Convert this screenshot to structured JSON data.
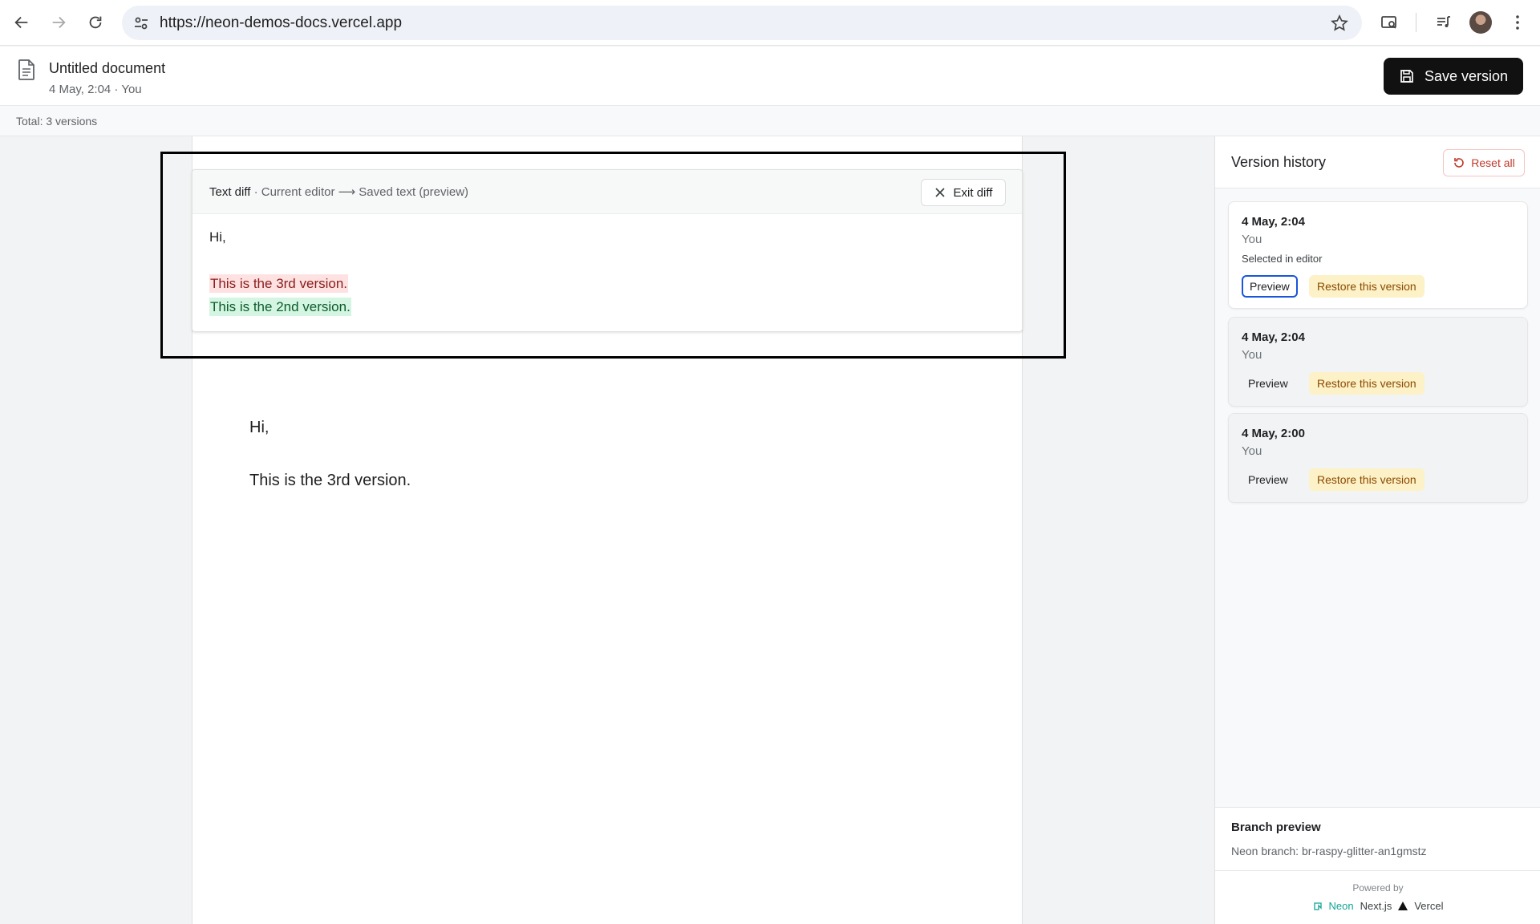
{
  "browser": {
    "url": "https://neon-demos-docs.vercel.app"
  },
  "header": {
    "title": "Untitled document",
    "meta": "4 May, 2:04 · You",
    "save_label": "Save version"
  },
  "totals": "Total: 3 versions",
  "diff": {
    "title_bold": "Text diff",
    "title_rest": " · Current editor ⟶ Saved text (preview)",
    "exit_label": "Exit diff",
    "lines": {
      "same": "Hi,",
      "removed": "This is the 3rd version.",
      "added": "This is the 2nd version."
    }
  },
  "editor": {
    "line1": "Hi,",
    "line2": "This is the 3rd version."
  },
  "sidebar": {
    "title": "Version history",
    "reset_label": "Reset all",
    "versions": [
      {
        "date": "4 May, 2:04",
        "author": "You",
        "note": "Selected in editor",
        "preview": "Preview",
        "restore": "Restore this version"
      },
      {
        "date": "4 May, 2:04",
        "author": "You",
        "preview": "Preview",
        "restore": "Restore this version"
      },
      {
        "date": "4 May, 2:00",
        "author": "You",
        "preview": "Preview",
        "restore": "Restore this version"
      }
    ],
    "branch_title": "Branch preview",
    "branch_name": "Neon branch: br-raspy-glitter-an1gmstz",
    "powered_by": "Powered by",
    "links": {
      "neon": "Neon",
      "next": "Next.js",
      "vercel": "Vercel"
    }
  },
  "colors": {
    "primary_button": "#111111",
    "removed_bg": "#fde2e1",
    "added_bg": "#d4f5e2",
    "restore_bg": "#fdf1c7",
    "active_outline": "#1a56db"
  }
}
